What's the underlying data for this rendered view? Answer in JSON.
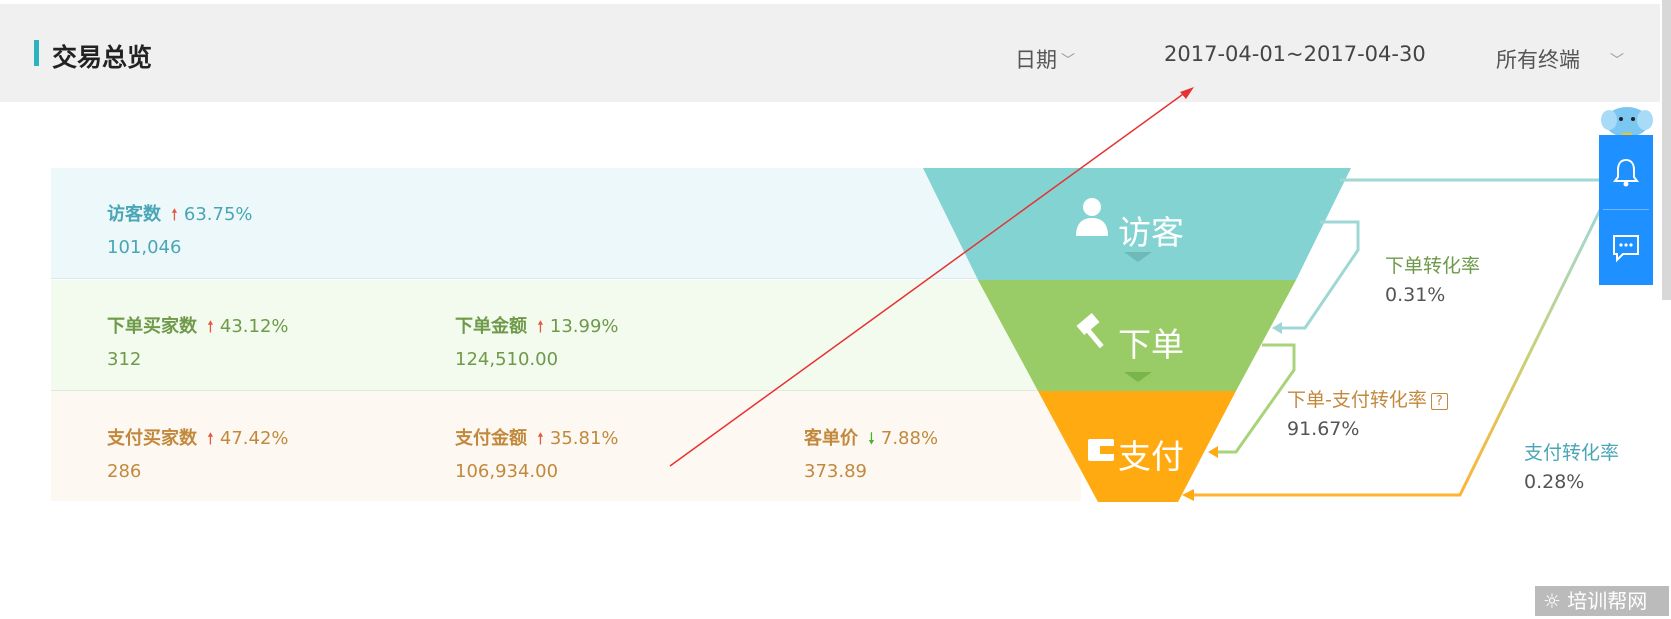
{
  "header": {
    "title": "交易总览",
    "date_label": "日期",
    "date_range": "2017-04-01~2017-04-30",
    "terminal": "所有终端"
  },
  "metrics": {
    "visitors": {
      "label": "访客数",
      "change": "63.75%",
      "value": "101,046"
    },
    "order_buyers": {
      "label": "下单买家数",
      "change": "43.12%",
      "value": "312"
    },
    "order_amount": {
      "label": "下单金额",
      "change": "13.99%",
      "value": "124,510.00"
    },
    "pay_buyers": {
      "label": "支付买家数",
      "change": "47.42%",
      "value": "286"
    },
    "pay_amount": {
      "label": "支付金额",
      "change": "35.81%",
      "value": "106,934.00"
    },
    "avg_price": {
      "label": "客单价",
      "change": "7.88%",
      "value": "373.89"
    }
  },
  "funnel": {
    "stage1": "访客",
    "stage2": "下单",
    "stage3": "支付",
    "order_rate": {
      "label": "下单转化率",
      "value": "0.31%"
    },
    "order_pay_rate": {
      "label": "下单-支付转化率",
      "help": "?",
      "value": "91.67%"
    },
    "pay_rate": {
      "label": "支付转化率",
      "value": "0.28%"
    }
  },
  "watermark": "培训帮网",
  "colors": {
    "teal": "#82d3d1",
    "green": "#99cc66",
    "orange": "#ffaa11",
    "accent": "#2bb3c0",
    "side_panel": "#1e90ff"
  }
}
